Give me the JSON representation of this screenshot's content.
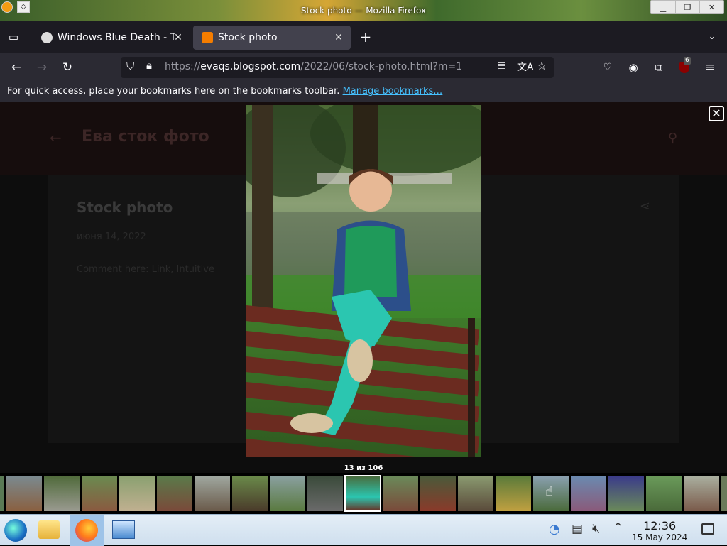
{
  "window": {
    "title": "Stock photo — Mozilla Firefox"
  },
  "tabs": [
    {
      "label": "Windows Blue Death - Te",
      "active": false
    },
    {
      "label": "Stock photo",
      "active": true
    }
  ],
  "urlbar": {
    "url_prefix": "https://",
    "url_host": "evaqs.blogspot.com",
    "url_path": "/2022/06/stock-photo.html?m=1"
  },
  "toolbar": {
    "extension_badge": "6"
  },
  "bookmarks_bar": {
    "message": "For quick access, place your bookmarks here on the bookmarks toolbar.",
    "link": "Manage bookmarks…"
  },
  "page": {
    "blog_title": "Ева сток фото",
    "post_title": "Stock photo",
    "post_date": "июня 14, 2022",
    "post_body": "Comment here: Link, Intuitive"
  },
  "lightbox": {
    "counter": "13 из 106",
    "active_index": 9
  },
  "taskbar": {
    "time": "12:36",
    "date": "15 May 2024"
  },
  "colors": {
    "accent_link": "#45c1ff",
    "firefox_dark": "#1c1b22",
    "blogger_orange": "#f57d00"
  }
}
